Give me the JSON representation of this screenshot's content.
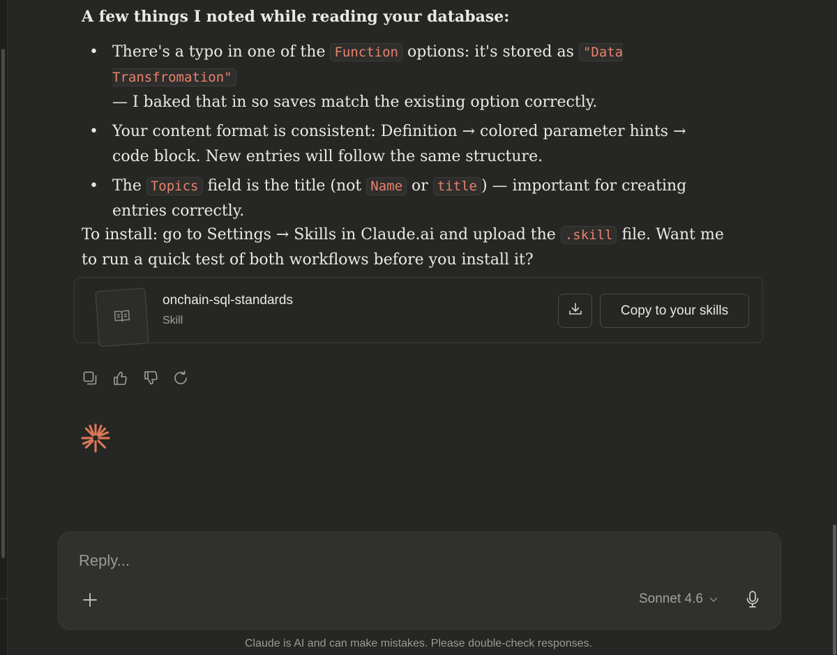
{
  "message": {
    "notes_title": "A few things I noted while reading your database:",
    "bullet_symbol": "•",
    "bullets": [
      {
        "part1": "There's a typo in one of the ",
        "code1": "Function",
        "part2": " options: it's stored as ",
        "code2": "\"Data Transfromation\"",
        "part3": " — I baked that in so saves match the existing option correctly."
      },
      {
        "text": "Your content format is consistent: Definition → colored parameter hints → code block. New entries will follow the same structure."
      },
      {
        "part1": "The ",
        "code1": "Topics",
        "part2": " field is the title (not ",
        "code2": "Name",
        "part3": " or ",
        "code3": "title",
        "part4": ") — important for creating entries correctly."
      }
    ],
    "install": {
      "part1": "To install: go to Settings → Skills in Claude.ai and upload the ",
      "code": ".skill",
      "part2": " file. Want me to run a quick test of both workflows before you install it?"
    }
  },
  "skill_card": {
    "name": "onchain-sql-standards",
    "type": "Skill",
    "icon": "book-icon",
    "download_icon": "download-icon",
    "copy_label": "Copy to your skills"
  },
  "actions": {
    "icons": [
      "copy-icon",
      "thumbs-up-icon",
      "thumbs-down-icon",
      "retry-icon"
    ]
  },
  "composer": {
    "placeholder": "Reply...",
    "plus_icon": "plus-icon",
    "model": "Sonnet 4.6",
    "mic_icon": "microphone-icon"
  },
  "footer": {
    "disclaimer": "Claude is AI and can make mistakes. Please double-check responses."
  },
  "colors": {
    "background": "#262624",
    "composer_bg": "#30302e",
    "code_text": "#e8826e",
    "accent_spark": "#d97757",
    "text": "#ebe9e3",
    "muted_text": "#9c9a95"
  }
}
